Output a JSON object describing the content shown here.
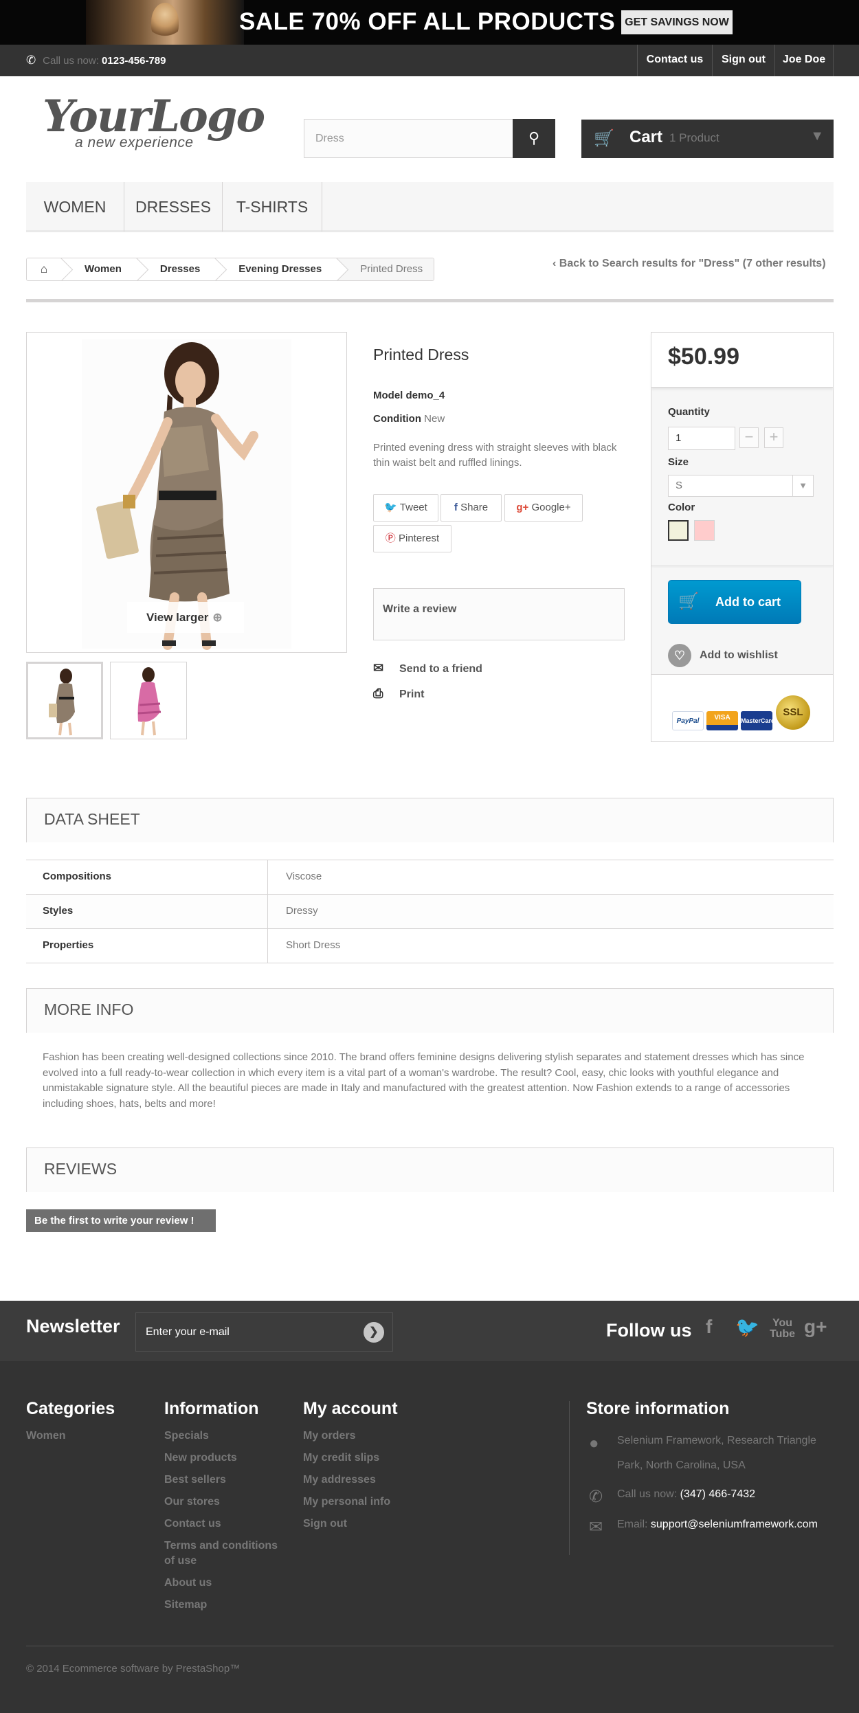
{
  "banner": {
    "sale_text": "SALE 70% OFF ALL PRODUCTS",
    "button": "GET SAVINGS NOW"
  },
  "topnav": {
    "call_label": "Call us now:",
    "phone": "0123-456-789",
    "links": [
      "Contact us",
      "Sign out",
      "Joe Doe"
    ]
  },
  "logo": {
    "line1": "YourLogo",
    "line2": "a new experience"
  },
  "search": {
    "value": "Dress"
  },
  "cart": {
    "title": "Cart",
    "count": "1 Product"
  },
  "menu": [
    "WOMEN",
    "DRESSES",
    "T-SHIRTS"
  ],
  "breadcrumb": [
    "Women",
    "Dresses",
    "Evening Dresses",
    "Printed Dress"
  ],
  "back_link": "Back to Search results for \"Dress\" (7 other results)",
  "image": {
    "view_larger": "View larger"
  },
  "product": {
    "name": "Printed Dress",
    "model_label": "Model",
    "model": "demo_4",
    "condition_label": "Condition",
    "condition": "New",
    "description": "Printed evening dress with straight sleeves with black thin waist belt and ruffled linings.",
    "share": [
      "Tweet",
      "Share",
      "Google+",
      "Pinterest"
    ],
    "write_review": "Write a review",
    "send_friend": "Send to a friend",
    "print": "Print"
  },
  "buy": {
    "price": "$50.99",
    "quantity_label": "Quantity",
    "quantity": "1",
    "size_label": "Size",
    "size": "S",
    "color_label": "Color",
    "colors": [
      "#f2f2dc",
      "#ffcccc"
    ],
    "add_to_cart": "Add to cart",
    "wishlist": "Add to wishlist",
    "payment": [
      "PayPal",
      "VISA",
      "MasterCard",
      "SSL"
    ]
  },
  "datasheet": {
    "title": "DATA SHEET",
    "rows": [
      {
        "key": "Compositions",
        "value": "Viscose"
      },
      {
        "key": "Styles",
        "value": "Dressy"
      },
      {
        "key": "Properties",
        "value": "Short Dress"
      }
    ]
  },
  "moreinfo": {
    "title": "MORE INFO",
    "text": "Fashion has been creating well-designed collections since 2010. The brand offers feminine designs delivering stylish separates and statement dresses which has since evolved into a full ready-to-wear collection in which every item is a vital part of a woman's wardrobe. The result? Cool, easy, chic looks with youthful elegance and unmistakable signature style. All the beautiful pieces are made in Italy and manufactured with the greatest attention. Now Fashion extends to a range of accessories including shoes, hats, belts and more!"
  },
  "reviews": {
    "title": "REVIEWS",
    "first": "Be the first to write your review !"
  },
  "newsletter": {
    "title": "Newsletter",
    "placeholder": "Enter your e-mail",
    "follow": "Follow us"
  },
  "footer": {
    "categories": {
      "title": "Categories",
      "items": [
        "Women"
      ]
    },
    "information": {
      "title": "Information",
      "items": [
        "Specials",
        "New products",
        "Best sellers",
        "Our stores",
        "Contact us",
        "Terms and conditions of use",
        "About us",
        "Sitemap"
      ]
    },
    "account": {
      "title": "My account",
      "items": [
        "My orders",
        "My credit slips",
        "My addresses",
        "My personal info",
        "Sign out"
      ]
    },
    "store": {
      "title": "Store information",
      "address": "Selenium Framework, Research Triangle Park, North Carolina, USA",
      "call_label": "Call us now:",
      "phone": "(347) 466-7432",
      "email_label": "Email:",
      "email": "support@seleniumframework.com"
    },
    "copyright": "© 2014 Ecommerce software by PrestaShop™"
  }
}
